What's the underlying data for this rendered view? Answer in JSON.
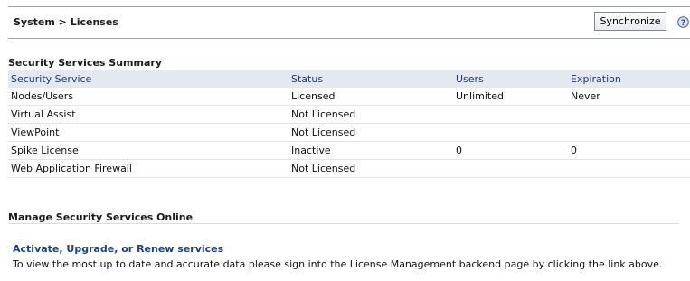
{
  "header": {
    "breadcrumb": "System > Licenses",
    "sync_label": "Synchronize",
    "help_icon": "help-icon"
  },
  "summary": {
    "title": "Security Services Summary",
    "columns": [
      "Security Service",
      "Status",
      "Users",
      "Expiration"
    ],
    "rows": [
      [
        "Nodes/Users",
        "Licensed",
        "Unlimited",
        "Never"
      ],
      [
        "Virtual Assist",
        "Not Licensed",
        "",
        ""
      ],
      [
        "ViewPoint",
        "Not Licensed",
        "",
        ""
      ],
      [
        "Spike License",
        "Inactive",
        "0",
        "0"
      ],
      [
        "Web Application Firewall",
        "Not Licensed",
        "",
        ""
      ]
    ]
  },
  "manage": {
    "title": "Manage Security Services Online",
    "link_text": "Activate, Upgrade, or Renew services",
    "link_suffix": ".",
    "info": "To view the most up to date and accurate data please sign into the License Management backend page by clicking the link above."
  },
  "colors": {
    "header_bg": "#e3e8f1",
    "header_text": "#1e3a74",
    "link": "#1a3f8b"
  }
}
